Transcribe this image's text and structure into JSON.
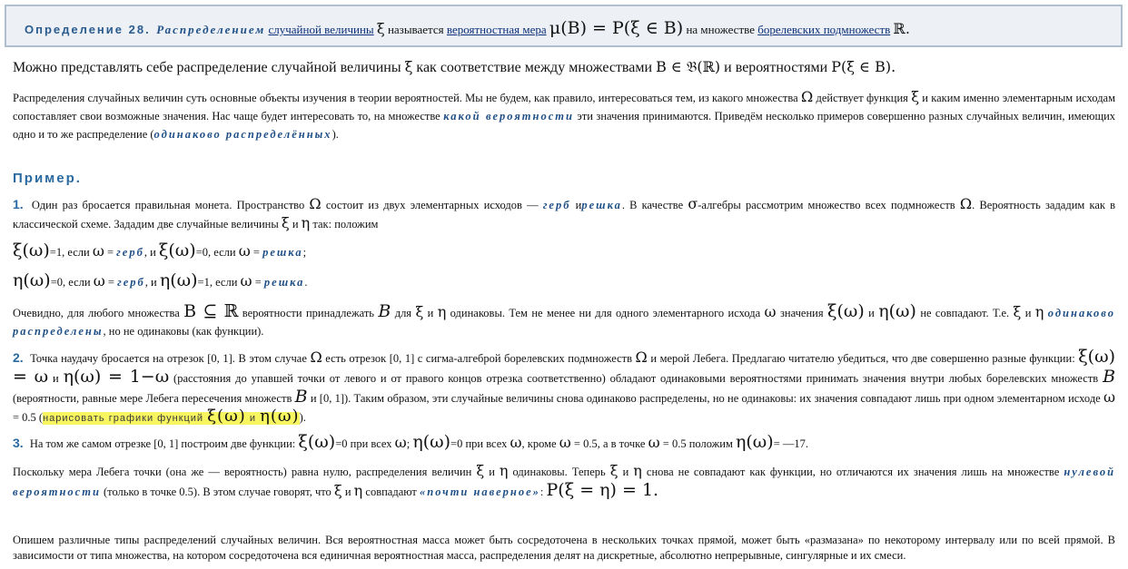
{
  "definition": {
    "label": "Определение 28.",
    "term": "Распределением",
    "link_random_variable": "случайной величины",
    "xi": "ξ",
    "is_called": "называется",
    "link_probability_measure": "вероятностная мера",
    "formula": "μ(B) = P(ξ ∈ B)",
    "on_set": "на множестве",
    "link_borel_sets": "борелевских подмножеств",
    "R": "ℝ."
  },
  "lead": {
    "text1": "Можно представлять себе распределение случайной величины",
    "xi": "ξ",
    "text2": "как соответствие между множествами",
    "formula1": "B ∈ 𝔅(ℝ)",
    "text3": "и вероятностями",
    "formula2": "P(ξ ∈ B)."
  },
  "intro": {
    "t1": "Распределения случайных величин суть основные объекты изучения в теории вероятностей. Мы не будем, как правило, интересоваться тем, из какого множества",
    "omega": "Ω",
    "t2": "действует функция",
    "xi": "ξ",
    "t3": "и каким именно элементарным исходам сопоставляет свои возможные значения. Нас чаще будет интересовать то, на множестве",
    "em1": "какой вероятности",
    "t4": "эти значения принимаются. Приведём несколько примеров совершенно разных случайных величин, имеющих одно и то же распределение (",
    "em2": "одинаково распределённых",
    "t5": ")."
  },
  "example_heading": "Пример.",
  "ex1": {
    "num": "1.",
    "t1": "Один раз бросается правильная монета. Пространство",
    "omega1": "Ω",
    "t2": "состоит из двух элементарных исходов —",
    "em_gerb": "герб",
    "and": "и",
    "em_reshka": "решка",
    "t3": ". В качестве",
    "sigma": "σ",
    "t4": "-алгебры рассмотрим множество всех подмножеств",
    "omega2": "Ω",
    "t5": ". Вероятность зададим как в классической схеме. Зададим две случайные величины",
    "xi": "ξ",
    "and2": "и",
    "eta": "η",
    "t6": "так: положим"
  },
  "formula_xi": {
    "f1": "ξ(ω)",
    "t1": "=1, если",
    "w1": "ω",
    "t2": "=",
    "gerb": "герб",
    "t3": ", и",
    "f2": "ξ(ω)",
    "t4": "=0, если",
    "w2": "ω",
    "t5": "=",
    "reshka": "решка",
    "t6": ";"
  },
  "formula_eta": {
    "f1": "η(ω)",
    "t1": "=0, если",
    "w1": "ω",
    "t2": "=",
    "gerb": "герб",
    "t3": ", и",
    "f2": "η(ω)",
    "t4": "=1, если",
    "w2": "ω",
    "t5": "=",
    "reshka": "решка",
    "t6": "."
  },
  "obvious": {
    "t1": "Очевидно, для любого множества",
    "f1": "B ⊆ ℝ",
    "t2": "вероятности принадлежать",
    "B": "B",
    "t3": "для",
    "xi": "ξ",
    "and1": "и",
    "eta": "η",
    "t4": "одинаковы. Тем не менее ни для одного элементарного исхода",
    "w": "ω",
    "t5": "значения",
    "f2": "ξ(ω)",
    "and2": "и",
    "f3": "η(ω)",
    "t6": "не совпадают. Т.е.",
    "xi2": "ξ",
    "and3": "и",
    "eta2": "η",
    "em": "одинаково распределены",
    "t7": ", но не одинаковы (как функции)."
  },
  "ex2": {
    "num": "2.",
    "t1": "Точка наудачу бросается на отрезок [0, 1]. В этом случае",
    "omega1": "Ω",
    "t2": "есть отрезок [0, 1] с сигма-алгеброй борелевских подмножеств",
    "omega2": "Ω",
    "t3": "и мерой Лебега. Предлагаю читателю убедиться, что две совершенно разные функции:",
    "f1": "ξ(ω) = ω",
    "and1": "и",
    "f2": "η(ω) = 1−ω",
    "t4": "(расстояния до упавшей точки от левого и от правого концов отрезка соответственно) обладают одинаковыми вероятностями принимать значения внутри любых борелевских множеств",
    "B1": "B",
    "t5": "(вероятности, равные мере Лебега пересечения множеств",
    "B2": "B",
    "t6": "и [0, 1]). Таким образом, эти случайные величины снова одинаково распределены, но не одинаковы: их значения совпадают лишь при одном элементарном исходе",
    "w": "ω",
    "t7": "= 0.5 (",
    "hl_text": "нарисовать графики функций",
    "hl_xi": "ξ(ω)",
    "hl_and": "и",
    "hl_eta": "η(ω)",
    "t8": ")."
  },
  "ex3": {
    "num": "3.",
    "t1": "На том же самом отрезке [0, 1] построим две функции:",
    "f1": "ξ(ω)",
    "t2": "=0 при всех",
    "w1": "ω",
    "t3": ";",
    "f2": "η(ω)",
    "t4": "=0 при всех",
    "w2": "ω",
    "t5": ", кроме",
    "w3": "ω",
    "t6": "= 0.5, а в точке",
    "w4": "ω",
    "t7": "= 0.5 положим",
    "f3": "η(ω)",
    "t8": "= —17."
  },
  "since": {
    "t1": "Поскольку мера Лебега точки (она же — вероятность) равна нулю, распределения величин",
    "xi": "ξ",
    "and1": "и",
    "eta": "η",
    "t2": "одинаковы. Теперь",
    "xi2": "ξ",
    "and2": "и",
    "eta2": "η",
    "t3": "снова не совпадают как функции, но отличаются их значения лишь на множестве",
    "em1": "нулевой вероятности",
    "t4": "(только в точке 0.5). В этом случае говорят, что",
    "xi3": "ξ",
    "and3": "и",
    "eta3": "η",
    "t5": "совпадают",
    "em2": "«почти наверное»",
    "t6": ":",
    "formula": "P(ξ = η) = 1."
  },
  "closing": {
    "text": "Опишем различные типы распределений случайных величин. Вся вероятностная масса может быть сосредоточена в нескольких точках прямой, может быть «размазана» по некоторому интервалу или по всей прямой. В зависимости от типа множества, на котором сосредоточена вся единичная вероятностная масса, распределения делят на дискретные, абсолютно непрерывные, сингулярные и их смеси."
  }
}
